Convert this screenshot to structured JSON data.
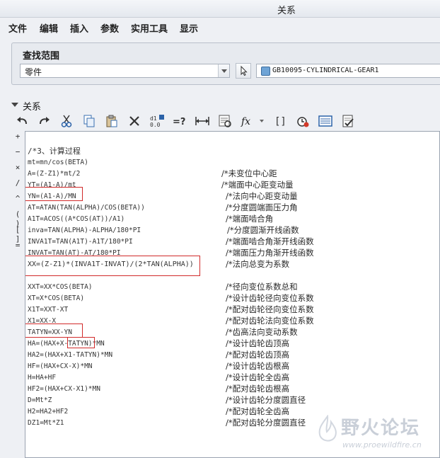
{
  "window": {
    "title": "关系"
  },
  "menu": [
    "文件",
    "编辑",
    "插入",
    "参数",
    "实用工具",
    "显示"
  ],
  "scope": {
    "label": "查找范围",
    "type_value": "零件",
    "model_value": "GB10095-CYLINDRICAL-GEAR1"
  },
  "relations": {
    "section_label": "关系",
    "toolbar": [
      "undo-icon",
      "redo-icon",
      "cut-icon",
      "copy-icon",
      "paste-icon",
      "delete-icon",
      "number-format-icon",
      "evaluate-icon",
      "dimension-icon",
      "properties-icon",
      "function-icon",
      "parameters-icon",
      "local-params-icon",
      "sort-icon",
      "verify-icon"
    ],
    "operators": [
      "+",
      "−",
      "×",
      "/",
      "^",
      "( )",
      "[ ]",
      "="
    ],
    "lines": [
      {
        "code": "/*3、计算过程",
        "comment": ""
      },
      {
        "code": "mt=mn/cos(BETA)",
        "comment": ""
      },
      {
        "code": "A=(Z-Z1)*mt/2",
        "comment": "/*未变位中心距"
      },
      {
        "code": "YT=(A1-A)/mt",
        "comment": "/*端面中心距变动量"
      },
      {
        "code": "YN=(A1-A)/MN",
        "comment": "/*法向中心距变动量"
      },
      {
        "code": "AT=ATAN(TAN(ALPHA)/COS(BETA))",
        "comment": "/*分度圆端面压力角"
      },
      {
        "code": "A1T=ACOS((A*COS(AT))/A1)",
        "comment": "/*端面啮合角"
      },
      {
        "code": "inva=TAN(ALPHA)-ALPHA/180*PI",
        "comment": " /*分度圆渐开线函数"
      },
      {
        "code": "INVA1T=TAN(A1T)-A1T/180*PI",
        "comment": "/*端面啮合角渐开线函数"
      },
      {
        "code": "INVAT=TAN(AT)-AT/180*PI",
        "comment": "/*端面压力角渐开线函数"
      },
      {
        "code": "XX=(Z-Z1)*(INVA1T-INVAT)/(2*TAN(ALPHA))",
        "comment": "/*法向总变为系数"
      },
      {
        "code": "",
        "comment": ""
      },
      {
        "code": "XXT=XX*COS(BETA)",
        "comment": "/*径向变位系数总和"
      },
      {
        "code": "XT=X*COS(BETA)",
        "comment": "/*设计齿轮径向变位系数"
      },
      {
        "code": "X1T=XXT-XT",
        "comment": "/*配对齿轮径向变位系数"
      },
      {
        "code": "X1=XX-X",
        "comment": "/*配对齿轮法向变位系数"
      },
      {
        "code": "TATYN=XX-YN",
        "comment": "/*齿高法向变动系数"
      },
      {
        "code": "HA=(HAX+X-TATYN)*MN",
        "comment": "/*设计齿轮齿顶高"
      },
      {
        "code": "HA2=(HAX+X1-TATYN)*MN",
        "comment": "/*配对齿轮齿顶高"
      },
      {
        "code": "HF=(HAX+CX-X)*MN",
        "comment": "/*设计齿轮齿根高"
      },
      {
        "code": "H=HA+HF",
        "comment": "/*设计齿轮全齿高"
      },
      {
        "code": "HF2=(HAX+CX-X1)*MN",
        "comment": "/*配对齿轮齿根高"
      },
      {
        "code": "D=Mt*Z",
        "comment": "/*设计齿轮分度圆直径"
      },
      {
        "code": "H2=HA2+HF2",
        "comment": "/*配对齿轮全齿高"
      },
      {
        "code": "DZ1=Mt*Z1",
        "comment": "/*配对齿轮分度圆直径"
      }
    ]
  },
  "watermark": {
    "name": "野火论坛",
    "url": "www.proewildfire.cn"
  }
}
